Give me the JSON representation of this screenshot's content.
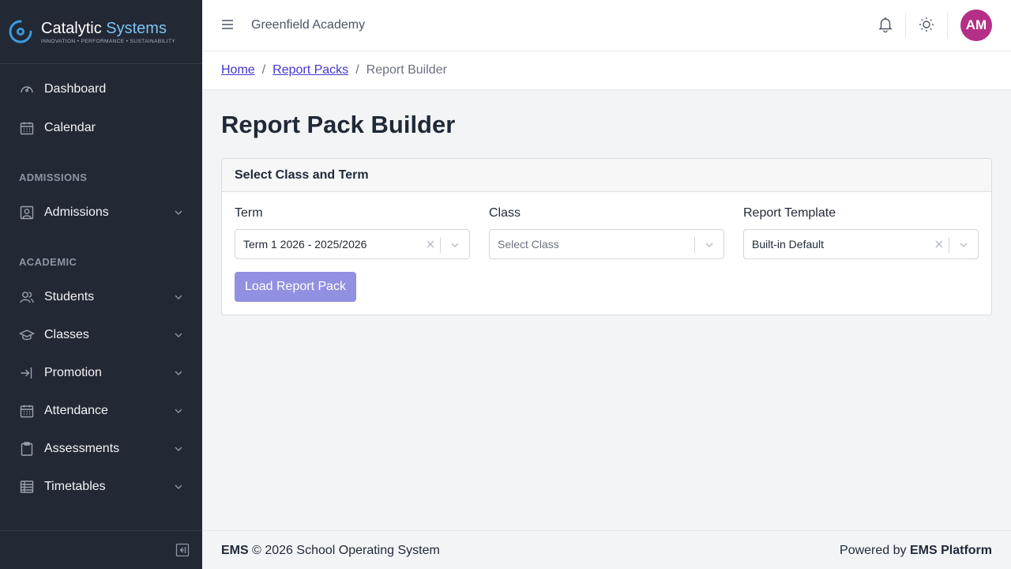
{
  "brand": {
    "name_primary": "Catalytic",
    "name_accent": "Systems",
    "tagline": "INNOVATION • PERFORMANCE • SUSTAINABILITY"
  },
  "sidebar": {
    "items_top": [
      {
        "label": "Dashboard",
        "icon": "gauge-icon"
      },
      {
        "label": "Calendar",
        "icon": "calendar-icon"
      }
    ],
    "sections": [
      {
        "label": "ADMISSIONS",
        "items": [
          {
            "label": "Admissions",
            "icon": "id-card-icon"
          }
        ]
      },
      {
        "label": "ACADEMIC",
        "items": [
          {
            "label": "Students",
            "icon": "users-icon"
          },
          {
            "label": "Classes",
            "icon": "graduation-cap-icon"
          },
          {
            "label": "Promotion",
            "icon": "arrow-right-icon"
          },
          {
            "label": "Attendance",
            "icon": "calendar-check-icon"
          },
          {
            "label": "Assessments",
            "icon": "clipboard-icon"
          },
          {
            "label": "Timetables",
            "icon": "table-icon"
          }
        ]
      }
    ]
  },
  "header": {
    "org_name": "Greenfield Academy",
    "avatar_initials": "AM",
    "avatar_color": "#b42f86"
  },
  "breadcrumb": {
    "home": "Home",
    "parent": "Report Packs",
    "current": "Report Builder",
    "separator": "/"
  },
  "page": {
    "title": "Report Pack Builder",
    "card_title": "Select Class and Term",
    "fields": {
      "term": {
        "label": "Term",
        "value": "Term 1 2026 - 2025/2026"
      },
      "class": {
        "label": "Class",
        "placeholder": "Select Class"
      },
      "template": {
        "label": "Report Template",
        "value": "Built-in Default"
      }
    },
    "load_button": "Load Report Pack",
    "accent_color": "#9290e0"
  },
  "footer": {
    "brand": "EMS",
    "copyright": "© 2026 School Operating System",
    "powered_prefix": "Powered by",
    "powered_brand": "EMS Platform"
  }
}
